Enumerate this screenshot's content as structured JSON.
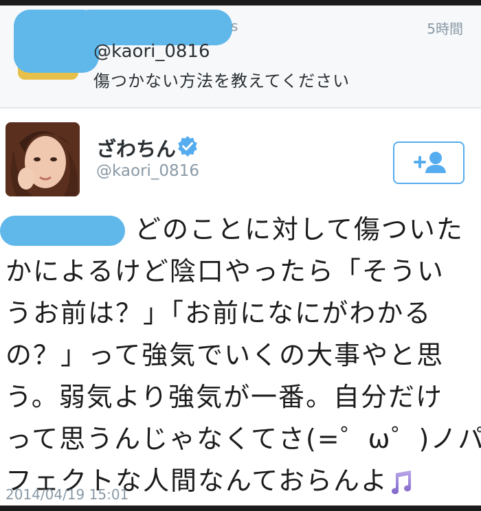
{
  "reply": {
    "name_tail": "s",
    "time": "5時間",
    "handle": "@kaori_0816",
    "text": "傷つかない方法を教えてください"
  },
  "tweet": {
    "display_name": "ざわちん",
    "handle": "@kaori_0816",
    "follow_icon": "follow-user-icon",
    "verified_icon": "verified-badge-icon",
    "body_lines": [
      "どのことに対して傷ついた",
      "かによるけど陰口やったら「そうい",
      "うお前は？」「お前になにがわかる",
      "の？」って強気でいくの大事やと思",
      "う。弱気より強気が一番。自分だけ",
      "って思うんじゃなくてさ(=゜ω゜)ノパー",
      "フェクトな人間なんておらんよ"
    ],
    "emoji_icon": "music-note-icon",
    "timestamp": "2014/04/19 15:01"
  },
  "colors": {
    "accent": "#55acee",
    "redaction": "#5fb7ea",
    "muted_text": "#8899a6"
  }
}
